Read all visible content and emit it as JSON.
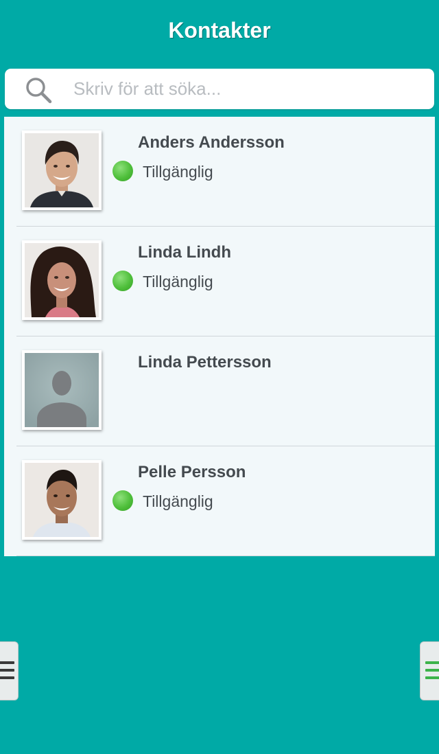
{
  "header": {
    "title": "Kontakter"
  },
  "search": {
    "placeholder": "Skriv för att söka...",
    "value": ""
  },
  "contacts": [
    {
      "name": "Anders Andersson",
      "status": "Tillgänglig",
      "status_color": "#4fbf3b",
      "avatar": "photo"
    },
    {
      "name": "Linda Lindh",
      "status": "Tillgänglig",
      "status_color": "#4fbf3b",
      "avatar": "photo"
    },
    {
      "name": "Linda Pettersson",
      "status": "",
      "avatar": "placeholder-silhouette"
    },
    {
      "name": "Pelle Persson",
      "status": "Tillgänglig",
      "status_color": "#4fbf3b",
      "avatar": "photo"
    }
  ],
  "colors": {
    "background": "#00aaa6",
    "list_background": "#f2f8fa",
    "status_available": "#4fbf3b"
  },
  "side_menus": {
    "left_icon": "hamburger-menu-icon",
    "right_icon": "hamburger-menu-icon"
  }
}
